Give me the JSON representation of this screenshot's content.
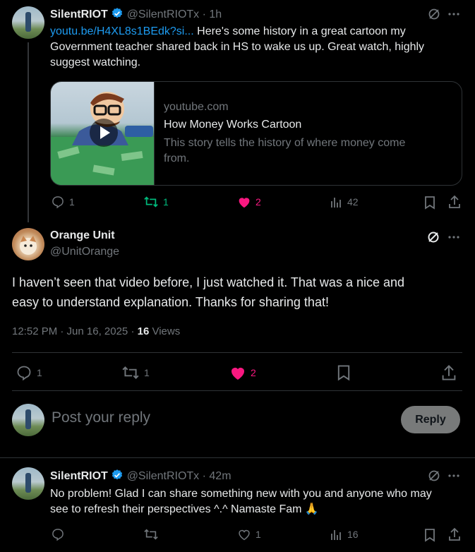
{
  "tweet1": {
    "name": "SilentRIOT",
    "handle": "@SilentRIOTx",
    "time": "· 1h",
    "link": "youtu.be/H4XL8s1BEdk?si...",
    "text_line1": " Here's some history in a great cartoon my",
    "text_line2": "Government teacher shared back in HS to wake us up. Great watch, highly",
    "text_line3": "suggest watching.",
    "card": {
      "domain": "youtube.com",
      "title": "How Money Works Cartoon",
      "desc_line1": "This story tells the history of where money come",
      "desc_line2": "from."
    },
    "actions": {
      "replies": "1",
      "reposts": "1",
      "likes": "2",
      "views": "42"
    }
  },
  "main_tweet": {
    "name": "Orange Unit",
    "handle": "@UnitOrange",
    "text_line1": "I haven’t seen that video before, I just watched it. That was a nice and",
    "text_line2": "easy to understand explanation. Thanks for sharing that!",
    "timestamp": "12:52 PM · Jun 16, 2025 · ",
    "views_count": "16",
    "views_label": " Views",
    "actions": {
      "replies": "1",
      "reposts": "1",
      "likes": "2"
    }
  },
  "reply_box": {
    "placeholder": "Post your reply",
    "button": "Reply"
  },
  "tweet3": {
    "name": "SilentRIOT",
    "handle": "@SilentRIOTx",
    "time": "· 42m",
    "text_line1": "No problem! Glad I can share something new with you and anyone who may",
    "text_line2": "see to refresh their perspectives ^.^ Namaste Fam 🙏",
    "actions": {
      "likes": "1",
      "views": "16"
    }
  },
  "colors": {
    "accent": "#1d9bf0",
    "like": "#f91880",
    "repost": "#00ba7c",
    "muted": "#71767b"
  }
}
